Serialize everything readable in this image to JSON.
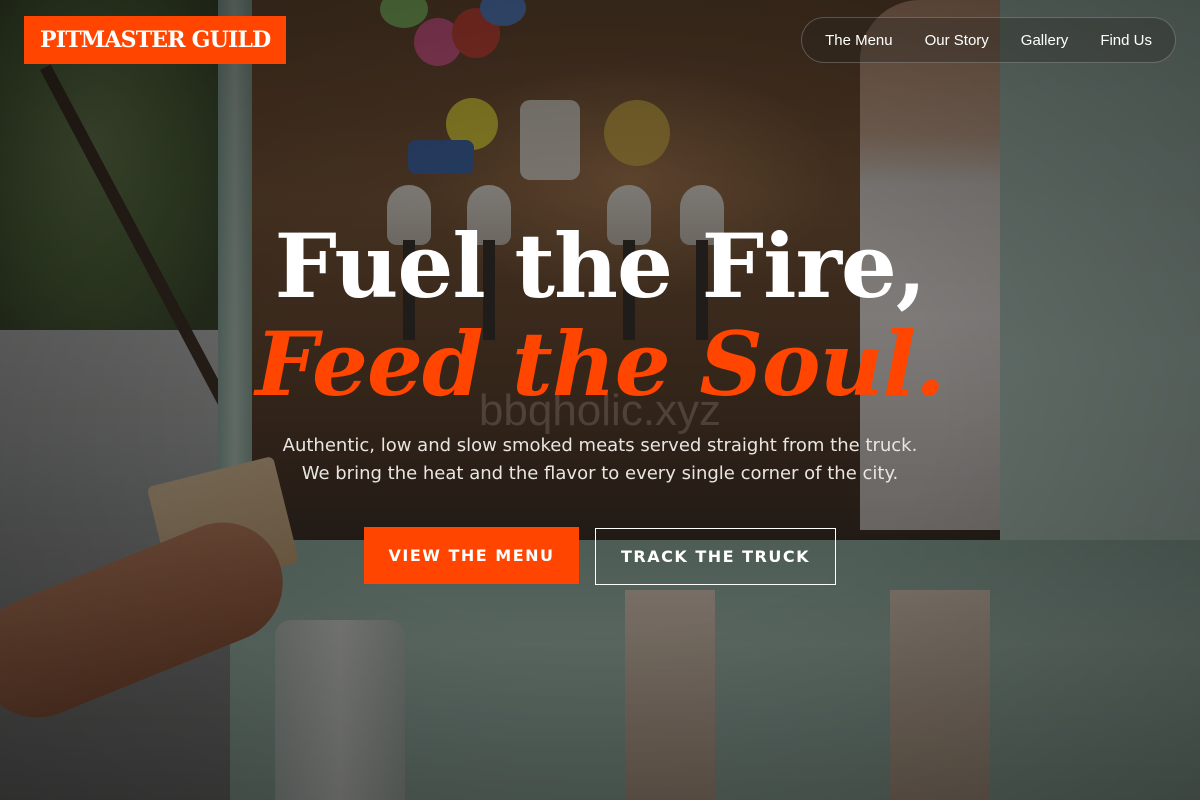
{
  "brand": {
    "name": "PITMASTER GUILD",
    "accent_color": "#ff4500"
  },
  "nav": {
    "items": [
      {
        "label": "The Menu"
      },
      {
        "label": "Our Story"
      },
      {
        "label": "Gallery"
      },
      {
        "label": "Find Us"
      }
    ]
  },
  "hero": {
    "headline_line1": "Fuel the Fire,",
    "headline_line2": "Feed the Soul.",
    "watermark": "bbqholic.xyz",
    "subtitle_line1": "Authentic, low and slow smoked meats served straight from the truck.",
    "subtitle_line2": "We bring the heat and the flavor to every single corner of the city.",
    "primary_button": "VIEW THE MENU",
    "secondary_button": "TRACK THE TRUCK"
  }
}
